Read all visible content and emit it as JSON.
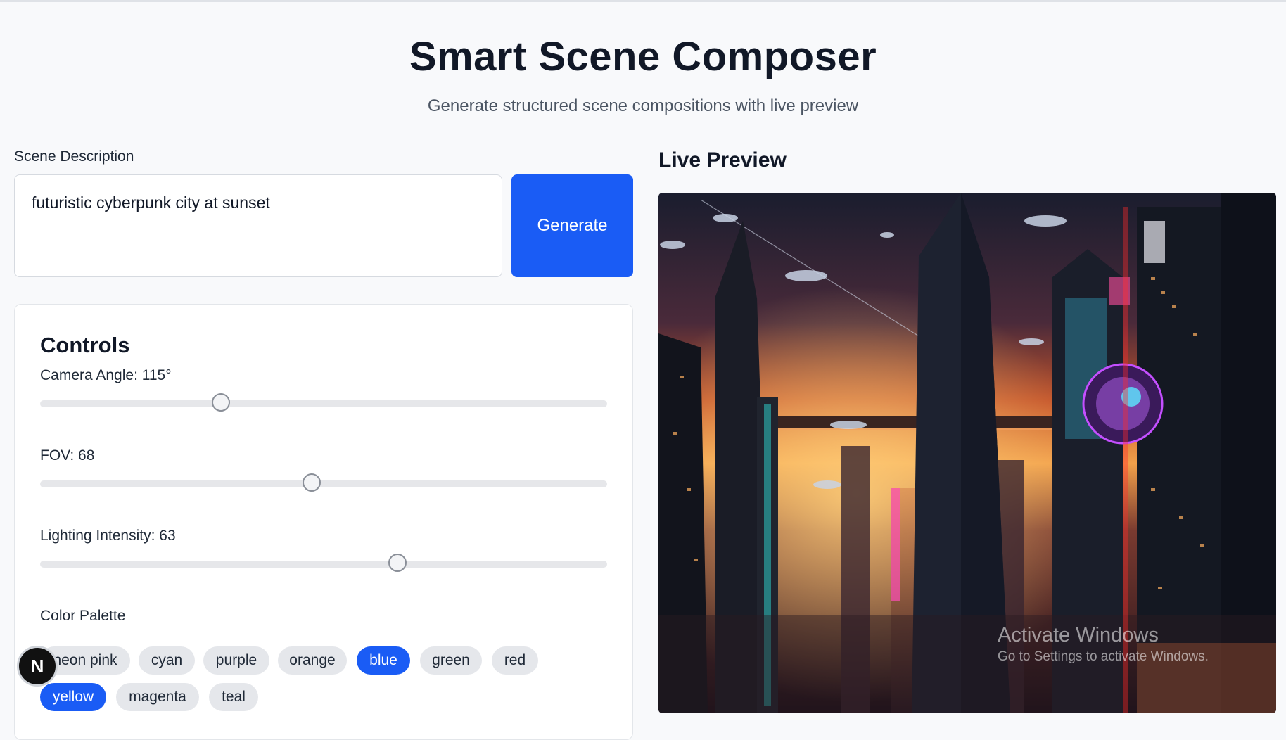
{
  "header": {
    "title": "Smart Scene Composer",
    "subtitle": "Generate structured scene compositions with live preview"
  },
  "scene": {
    "label": "Scene Description",
    "value": "futuristic cyberpunk city at sunset",
    "generate_label": "Generate"
  },
  "controls": {
    "title": "Controls",
    "camera_angle": {
      "label": "Camera Angle: 115°",
      "value": 115,
      "min": 0,
      "max": 360
    },
    "fov": {
      "label": "FOV: 68",
      "value": 68,
      "min": 0,
      "max": 142
    },
    "lighting": {
      "label": "Lighting Intensity: 63",
      "value": 63,
      "min": 0,
      "max": 100
    },
    "palette_label": "Color Palette",
    "palette": [
      {
        "label": "neon pink",
        "selected": false
      },
      {
        "label": "cyan",
        "selected": false
      },
      {
        "label": "purple",
        "selected": false
      },
      {
        "label": "orange",
        "selected": false
      },
      {
        "label": "blue",
        "selected": true
      },
      {
        "label": "green",
        "selected": false
      },
      {
        "label": "red",
        "selected": false
      },
      {
        "label": "yellow",
        "selected": true
      },
      {
        "label": "magenta",
        "selected": false
      },
      {
        "label": "teal",
        "selected": false
      }
    ]
  },
  "preview": {
    "title": "Live Preview"
  },
  "watermark": {
    "line1": "Activate Windows",
    "line2": "Go to Settings to activate Windows."
  },
  "badge": {
    "letter": "N"
  },
  "colors": {
    "accent": "#1a5cf5",
    "chip_bg": "#e5e7eb"
  }
}
